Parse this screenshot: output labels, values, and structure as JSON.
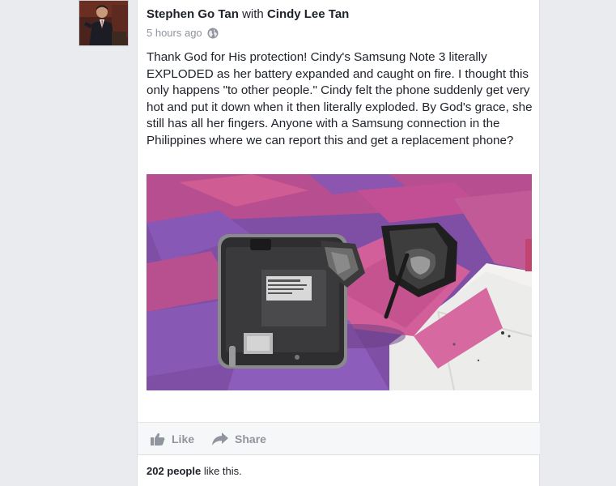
{
  "post": {
    "author": "Stephen Go Tan",
    "with_word": "with",
    "tagged": "Cindy Lee Tan",
    "time": "5 hours ago",
    "privacy_icon": "globe-icon",
    "text": "Thank God for His protection! Cindy's Samsung Note 3 literally EXPLODED as her battery expanded and caught on fire. I thought this only happens \"to other people.\" Cindy felt the phone suddenly get very hot and put it down when it then literally exploded. By God's grace, she still has all her fingers. Anyone with a Samsung connection in the Philippines where we can report this and get a replacement phone?"
  },
  "actions": {
    "like_label": "Like",
    "like_icon": "thumbs-up-icon",
    "share_label": "Share",
    "share_icon": "share-arrow-icon"
  },
  "likes": {
    "count_text": "202 people",
    "suffix": " like this."
  },
  "colors": {
    "link": "#1d2129",
    "meta": "#90949c",
    "action": "#90949c",
    "page_bg": "#e9ebee"
  }
}
